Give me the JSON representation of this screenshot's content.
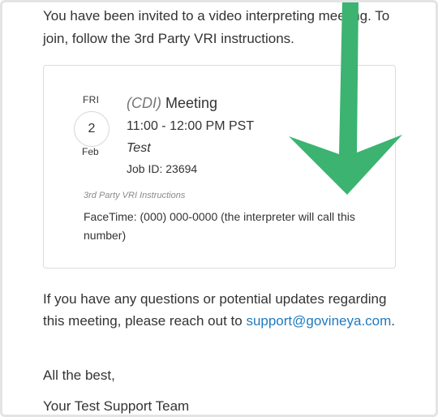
{
  "intro": {
    "text": "You have been invited to a video interpreting meeting. To join, follow the 3rd Party VRI instructions."
  },
  "meeting": {
    "day_of_week": "FRI",
    "day": "2",
    "month": "Feb",
    "language": "(CDI)",
    "title": "Meeting",
    "time": "11:00 - 12:00 PM PST",
    "name": "Test",
    "job_id": "Job ID: 23694",
    "vri_label": "3rd Party VRI Instructions",
    "vri_instructions": "FaceTime: (000) 000-0000 (the interpreter will call this number)"
  },
  "closing": {
    "questions_text": "If you have any questions or potential updates regarding this meeting, please reach out to",
    "support_email": "support@govineya.com",
    "period": ".",
    "sign_off": "All the best,",
    "team": "Your Test Support Team"
  },
  "annotation": {
    "arrow_color": "#3cb371"
  }
}
